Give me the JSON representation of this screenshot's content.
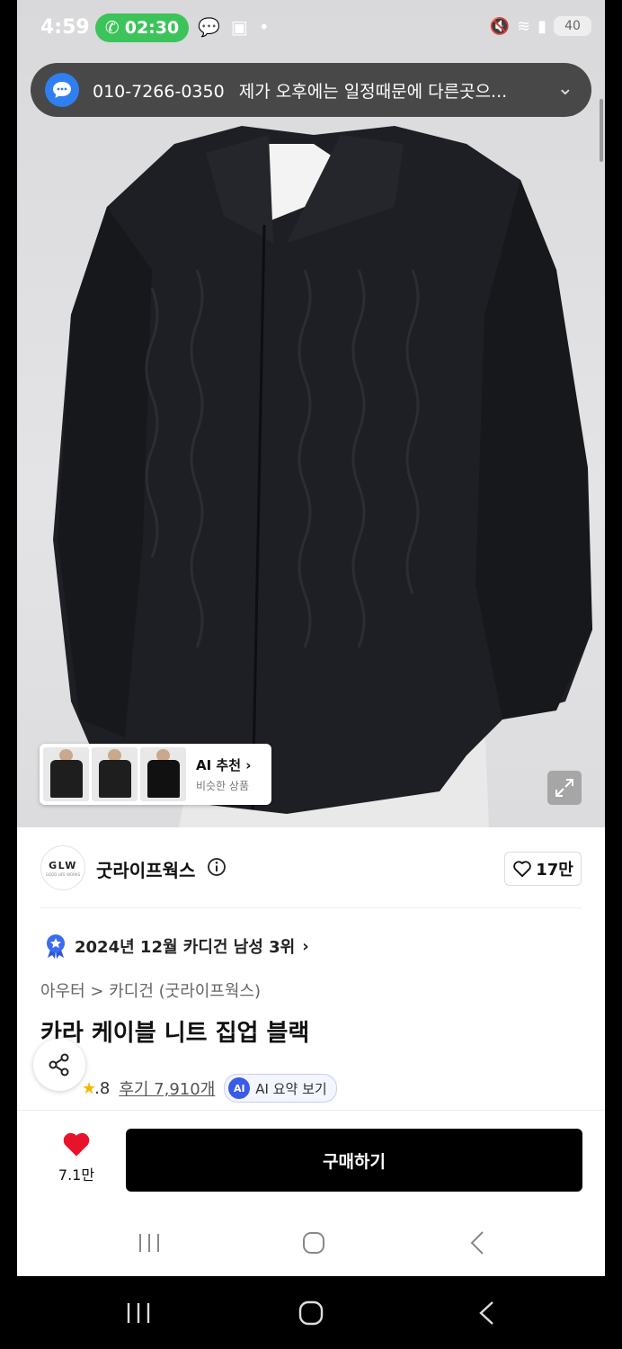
{
  "status_bar": {
    "time": "4:59",
    "call_timer": "02:30",
    "battery": "40"
  },
  "notification": {
    "sender": "010-7266-0350",
    "message": "제가 오후에는 일정때문에 다른곳으..."
  },
  "hero": {
    "ai_reco_title": "AI 추천",
    "ai_reco_subtitle": "비슷한 상품"
  },
  "brand": {
    "logo_text": "GLW",
    "logo_sub": "GOOD LIFE WORKS",
    "name": "굿라이프웍스",
    "likes": "17만"
  },
  "ranking": {
    "text": "2024년 12월 카디건 남성 3위"
  },
  "product": {
    "breadcrumb": "아우터 > 카디건 (굿라이프웍스)",
    "title": "카라 케이블 니트 집업 블랙",
    "rating": ".8",
    "reviews": "후기 7,910개",
    "ai_summary_label": "AI 요약 보기",
    "ai_badge": "AI"
  },
  "actions": {
    "wish_count": "7.1만",
    "buy_label": "구매하기"
  }
}
